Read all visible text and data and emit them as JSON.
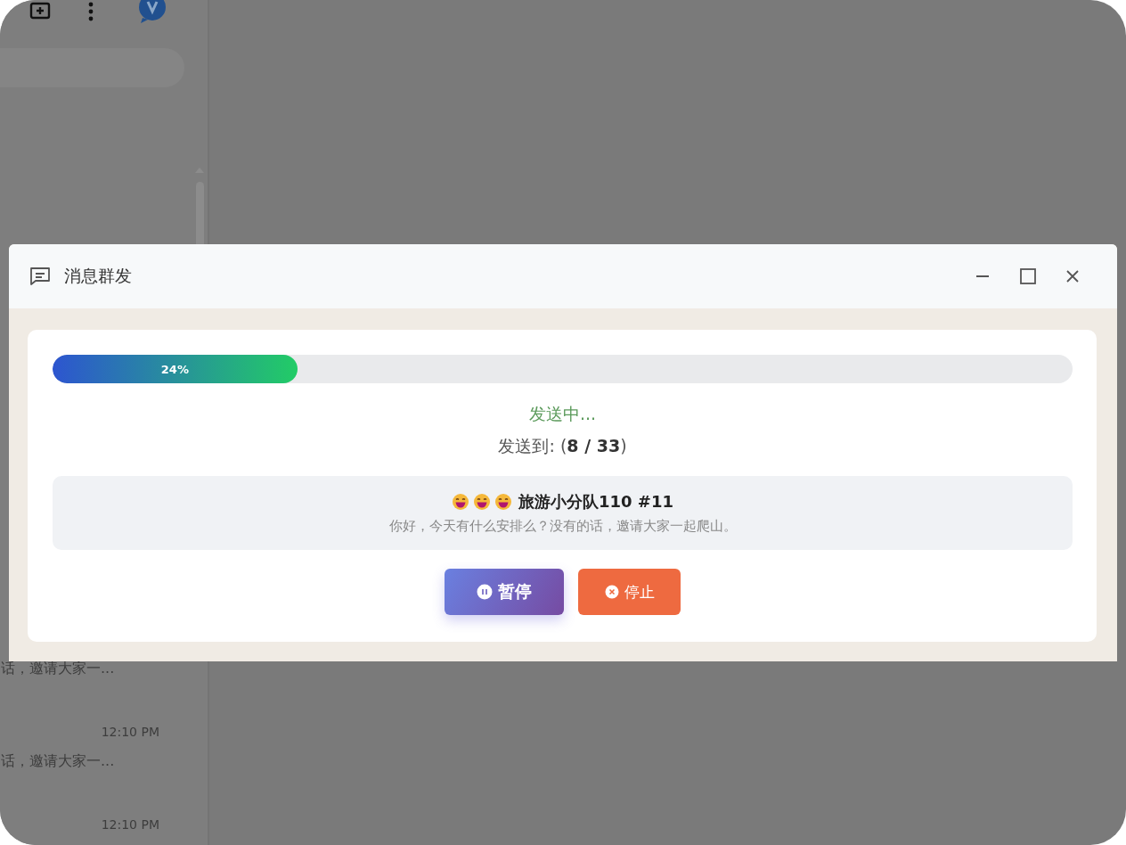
{
  "sidebar": {
    "chats": [
      {
        "preview": "话，邀请大家一...",
        "time": "12:10 PM"
      },
      {
        "preview": "话，邀请大家一...",
        "time": "12:10 PM"
      }
    ]
  },
  "dialog": {
    "title": "消息群发",
    "progress": {
      "level": 0.24,
      "label": "24%"
    },
    "status": "发送中...",
    "counter": "发送到: (**8 / 33**)",
    "current": {
      "name": "旅游小分队110 #11",
      "message": "你好，今天有什么安排么？没有的话，邀请大家一起爬山。"
    },
    "buttons": [
      {
        "kind": "pause",
        "label": "暂停"
      },
      {
        "kind": "stop",
        "label": "停止"
      }
    ]
  }
}
